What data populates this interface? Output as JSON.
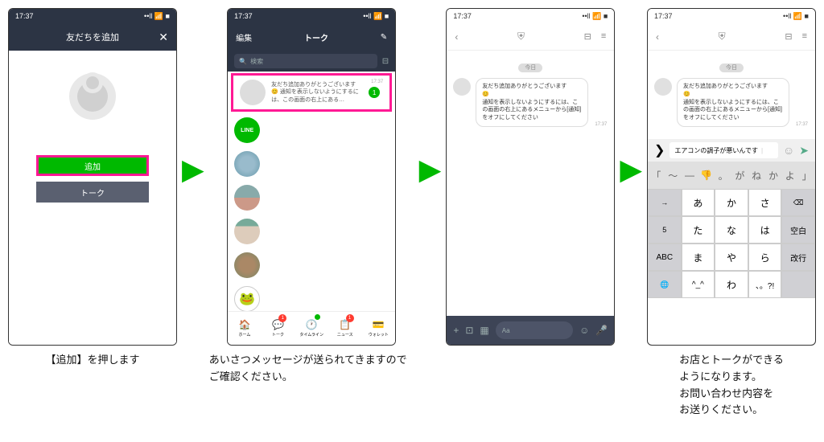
{
  "status": {
    "time": "17:37",
    "icons": "••ll 📶 ■"
  },
  "p1": {
    "title": "友だちを追加",
    "add": "追加",
    "talk": "トーク"
  },
  "p2": {
    "edit": "編集",
    "title": "トーク",
    "search": "検索",
    "item_text": "友だち追加ありがとうございます 😊 通知を表示しないようにするには、この画面の右上にある…",
    "item_time": "17:37",
    "badge": "1",
    "tabs": {
      "home": "ホーム",
      "talk": "トーク",
      "timeline": "タイムライン",
      "news": "ニュース",
      "wallet": "ウォレット"
    },
    "talk_badge": "1",
    "news_badge": "1"
  },
  "chat": {
    "date": "今日",
    "line1": "友だち追加ありがとうございます",
    "emoji": "😊",
    "line2": "通知を表示しないようにするには、この画面の右上にあるメニューから[通知]をオフにしてください",
    "time": "17:37",
    "placeholder": "Aa"
  },
  "kb": {
    "suggest": "エアコンの調子が悪いんです",
    "row0": [
      "「",
      "〜",
      "—",
      "👎",
      "。",
      "が",
      "ね",
      "か",
      "よ",
      "」"
    ],
    "rows": [
      [
        "→",
        "あ",
        "か",
        "さ",
        "⌫"
      ],
      [
        "5",
        "た",
        "な",
        "は",
        "空白"
      ],
      [
        "ABC",
        "ま",
        "や",
        "ら",
        "改行"
      ],
      [
        "🌐",
        "^_^",
        "わ",
        "、。?!",
        ""
      ]
    ]
  },
  "captions": {
    "c1": "【追加】を押します",
    "c2": "あいさつメッセージが送られてきますのでご確認ください。",
    "c3": "お店とトークができる\nようになります。\nお問い合わせ内容を\nお送りください。"
  }
}
